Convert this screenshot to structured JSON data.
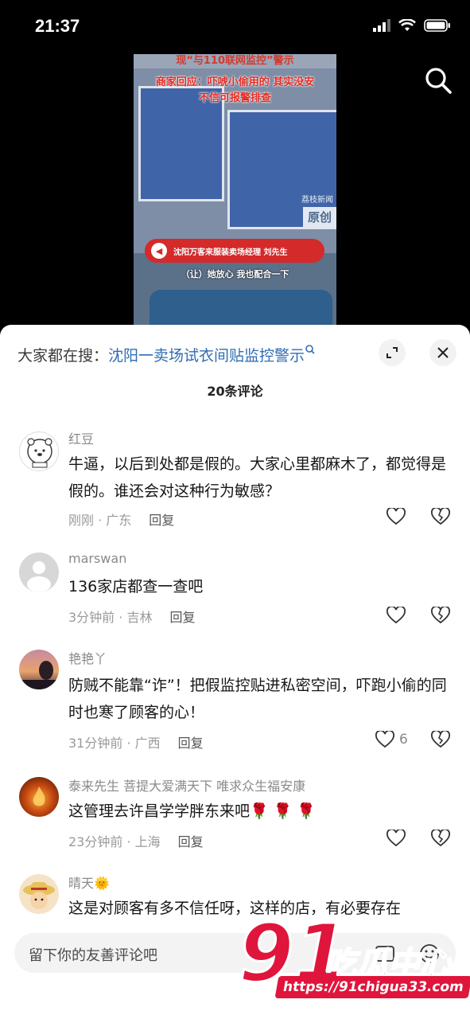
{
  "status_bar": {
    "time": "21:37"
  },
  "video": {
    "top_caption": "现“与110联网监控”警示",
    "caption_line1": "商家回应：吓唬小偷用的 其实没安",
    "caption_line2": "不信可报警排查",
    "source_watermark": "荔枝新闻",
    "original_badge": "原创",
    "name_bar": "沈阳万客来服装卖场经理 刘先生",
    "subtitle": "（让）她放心 我也配合一下"
  },
  "sheet": {
    "hot_search_prefix": "大家都在搜：",
    "hot_search_query": "沈阳一卖场试衣间贴监控警示",
    "comment_count": "20条评论"
  },
  "comments": [
    {
      "name": "红豆",
      "text": "牛逼，以后到处都是假的。大家心里都麻木了，都觉得是假的。谁还会对这种行为敏感？",
      "time": "刚刚 · 广东",
      "reply": "回复",
      "likes": ""
    },
    {
      "name": "marswan",
      "text": "136家店都查一查吧",
      "time": "3分钟前 · 吉林",
      "reply": "回复",
      "likes": ""
    },
    {
      "name": "艳艳丫",
      "text": "防贼不能靠“诈”！把假监控贴进私密空间，吓跑小偷的同时也寒了顾客的心！",
      "time": "31分钟前 · 广西",
      "reply": "回复",
      "likes": "6"
    },
    {
      "name": "泰来先生 菩提大爱满天下 唯求众生福安康",
      "text": "这管理去许昌学学胖东来吧🌹 🌹 🌹",
      "time": "23分钟前 · 上海",
      "reply": "回复",
      "likes": ""
    },
    {
      "name": "晴天🌞",
      "text": "这是对顾客有多不信任呀，这样的店，有必要存在",
      "time": "",
      "reply": "",
      "likes": ""
    }
  ],
  "input": {
    "placeholder": "留下你的友善评论吧"
  },
  "watermark": {
    "logo_number": "91",
    "logo_name": "吃瓜中心",
    "url": "https://91chigua33.com"
  },
  "colors": {
    "link_blue": "#2f6db5",
    "brand_red": "#e0153c"
  },
  "icons": [
    "search-icon",
    "expand-icon",
    "close-icon",
    "heart-icon",
    "broken-heart-icon",
    "image-icon",
    "emoji-icon"
  ]
}
